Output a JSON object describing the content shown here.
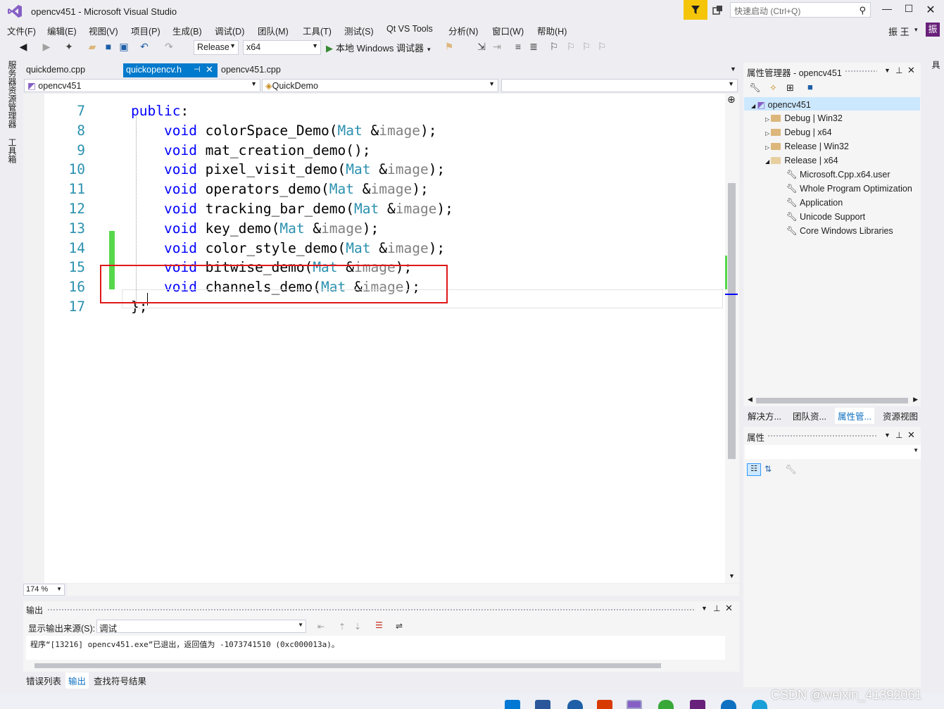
{
  "window": {
    "title": "opencv451 - Microsoft Visual Studio",
    "quick_launch_placeholder": "快速启动 (Ctrl+Q)",
    "user_name": "振 王",
    "user_avatar": "振"
  },
  "menu": [
    "文件(F)",
    "编辑(E)",
    "视图(V)",
    "项目(P)",
    "生成(B)",
    "调试(D)",
    "团队(M)",
    "工具(T)",
    "测试(S)",
    "Qt VS Tools",
    "分析(N)",
    "窗口(W)",
    "帮助(H)"
  ],
  "toolbar": {
    "configuration": "Release",
    "platform": "x64",
    "run_label": "本地 Windows 调试器"
  },
  "left_strip": [
    "服务器资源管理器",
    "工具箱"
  ],
  "right_strip": [
    "诊断工具"
  ],
  "editor_tabs": [
    {
      "label": "quickdemo.cpp",
      "active": false
    },
    {
      "label": "quickopencv.h",
      "active": true
    },
    {
      "label": "opencv451.cpp",
      "active": false
    }
  ],
  "navbar": {
    "project": "opencv451",
    "scope": "QuickDemo",
    "member": ""
  },
  "code_lines": [
    {
      "n": "7",
      "parts": [
        {
          "c": "kw",
          "t": "public"
        },
        {
          "c": "tx",
          "t": ":"
        }
      ]
    },
    {
      "n": "8",
      "parts": [
        {
          "c": "tx",
          "t": "    "
        },
        {
          "c": "kw",
          "t": "void"
        },
        {
          "c": "tx",
          "t": " colorSpace_Demo("
        },
        {
          "c": "ty",
          "t": "Mat"
        },
        {
          "c": "tx",
          "t": " &"
        },
        {
          "c": "pa",
          "t": "image"
        },
        {
          "c": "tx",
          "t": ");"
        }
      ]
    },
    {
      "n": "9",
      "parts": [
        {
          "c": "tx",
          "t": "    "
        },
        {
          "c": "kw",
          "t": "void"
        },
        {
          "c": "tx",
          "t": " mat_creation_demo();"
        }
      ]
    },
    {
      "n": "10",
      "parts": [
        {
          "c": "tx",
          "t": "    "
        },
        {
          "c": "kw",
          "t": "void"
        },
        {
          "c": "tx",
          "t": " pixel_visit_demo("
        },
        {
          "c": "ty",
          "t": "Mat"
        },
        {
          "c": "tx",
          "t": " &"
        },
        {
          "c": "pa",
          "t": "image"
        },
        {
          "c": "tx",
          "t": ");"
        }
      ]
    },
    {
      "n": "11",
      "parts": [
        {
          "c": "tx",
          "t": "    "
        },
        {
          "c": "kw",
          "t": "void"
        },
        {
          "c": "tx",
          "t": " operators_demo("
        },
        {
          "c": "ty",
          "t": "Mat"
        },
        {
          "c": "tx",
          "t": " &"
        },
        {
          "c": "pa",
          "t": "image"
        },
        {
          "c": "tx",
          "t": ");"
        }
      ]
    },
    {
      "n": "12",
      "parts": [
        {
          "c": "tx",
          "t": "    "
        },
        {
          "c": "kw",
          "t": "void"
        },
        {
          "c": "tx",
          "t": " tracking_bar_demo("
        },
        {
          "c": "ty",
          "t": "Mat"
        },
        {
          "c": "tx",
          "t": " &"
        },
        {
          "c": "pa",
          "t": "image"
        },
        {
          "c": "tx",
          "t": ");"
        }
      ]
    },
    {
      "n": "13",
      "parts": [
        {
          "c": "tx",
          "t": "    "
        },
        {
          "c": "kw",
          "t": "void"
        },
        {
          "c": "tx",
          "t": " key_demo("
        },
        {
          "c": "ty",
          "t": "Mat"
        },
        {
          "c": "tx",
          "t": " &"
        },
        {
          "c": "pa",
          "t": "image"
        },
        {
          "c": "tx",
          "t": ");"
        }
      ]
    },
    {
      "n": "14",
      "parts": [
        {
          "c": "tx",
          "t": "    "
        },
        {
          "c": "kw",
          "t": "void"
        },
        {
          "c": "tx",
          "t": " color_style_demo("
        },
        {
          "c": "ty",
          "t": "Mat"
        },
        {
          "c": "tx",
          "t": " &"
        },
        {
          "c": "pa",
          "t": "image"
        },
        {
          "c": "tx",
          "t": ");"
        }
      ]
    },
    {
      "n": "15",
      "parts": [
        {
          "c": "tx",
          "t": "    "
        },
        {
          "c": "kw",
          "t": "void"
        },
        {
          "c": "tx",
          "t": " bitwise_demo("
        },
        {
          "c": "ty",
          "t": "Mat"
        },
        {
          "c": "tx",
          "t": " &"
        },
        {
          "c": "pa",
          "t": "image"
        },
        {
          "c": "tx",
          "t": ");"
        }
      ]
    },
    {
      "n": "16",
      "parts": [
        {
          "c": "tx",
          "t": "    "
        },
        {
          "c": "kw",
          "t": "void"
        },
        {
          "c": "tx",
          "t": " channels_demo("
        },
        {
          "c": "ty",
          "t": "Mat"
        },
        {
          "c": "tx",
          "t": " &"
        },
        {
          "c": "pa",
          "t": "image"
        },
        {
          "c": "tx",
          "t": ");"
        }
      ]
    },
    {
      "n": "17",
      "parts": [
        {
          "c": "tx",
          "t": "};"
        }
      ]
    }
  ],
  "zoom": "174 %",
  "output": {
    "title": "输出",
    "source_label": "显示输出来源(S):",
    "source_value": "调试",
    "text": "程序“[13216] opencv451.exe”已退出，返回值为 -1073741510 (0xc000013a)。"
  },
  "bottom_tabs": [
    {
      "label": "错误列表",
      "active": false
    },
    {
      "label": "输出",
      "active": true
    },
    {
      "label": "查找符号结果",
      "active": false
    }
  ],
  "property_manager": {
    "title": "属性管理器 - opencv451",
    "root": "opencv451",
    "items": [
      {
        "label": "Debug | Win32",
        "kind": "folder",
        "expanded": false
      },
      {
        "label": "Debug | x64",
        "kind": "folder",
        "expanded": false
      },
      {
        "label": "Release | Win32",
        "kind": "folder",
        "expanded": false
      },
      {
        "label": "Release | x64",
        "kind": "folder",
        "expanded": true
      }
    ],
    "sheets": [
      "Microsoft.Cpp.x64.user",
      "Whole Program Optimization",
      "Application",
      "Unicode Support",
      "Core Windows Libraries"
    ]
  },
  "side_tabs": [
    {
      "label": "解决方...",
      "active": false
    },
    {
      "label": "团队资...",
      "active": false
    },
    {
      "label": "属性管...",
      "active": true
    },
    {
      "label": "资源视图",
      "active": false
    }
  ],
  "properties_title": "属性",
  "watermark": "CSDN @weixin_41392061",
  "colors": {
    "accent": "#007acc",
    "highlight_box": "#e01818",
    "change_bar": "#57d74b",
    "filter": "#f5c50a"
  }
}
